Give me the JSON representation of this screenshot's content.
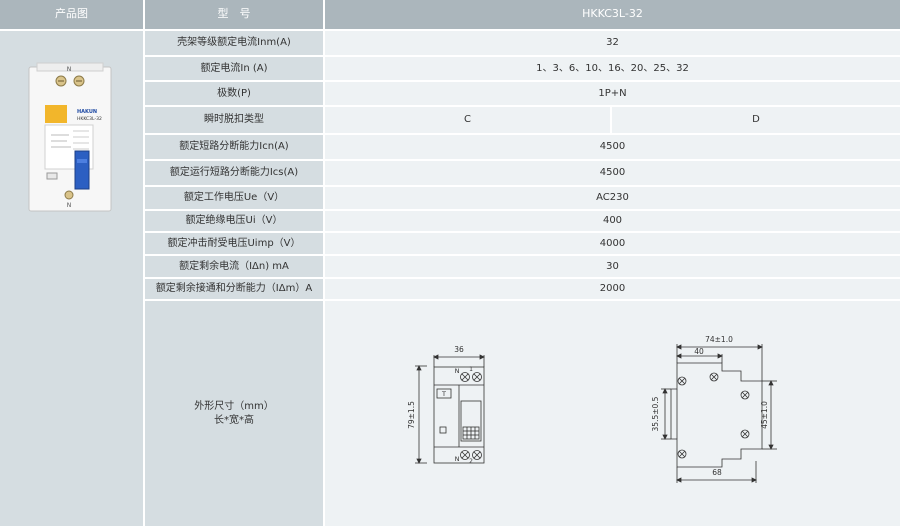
{
  "header": {
    "image_col": "产品图",
    "model_col": "型　号",
    "model_value": "HKKC3L-32"
  },
  "rows": [
    {
      "label": "壳架等级额定电流Inm(A)",
      "value": "32"
    },
    {
      "label": "额定电流In (A)",
      "value": "1、3、6、10、16、20、25、32"
    },
    {
      "label": "极数(P)",
      "value": "1P+N"
    },
    {
      "label": "瞬时脱扣类型",
      "value_c": "C",
      "value_d": "D"
    },
    {
      "label": "额定短路分断能力Icn(A)",
      "value": "4500"
    },
    {
      "label": "额定运行短路分断能力Ics(A)",
      "value": "4500"
    },
    {
      "label": "额定工作电压Ue（V）",
      "value": "AC230"
    },
    {
      "label": "额定绝缘电压Ui（V）",
      "value": "400"
    },
    {
      "label": "额定冲击耐受电压Uimp（V）",
      "value": "4000"
    },
    {
      "label": "额定剩余电流（IΔn) mA",
      "value": "30"
    },
    {
      "label": "额定剩余接通和分断能力（IΔm）A",
      "value": "2000"
    }
  ],
  "dimensions": {
    "label_line1": "外形尺寸（mm）",
    "label_line2": "长*宽*高",
    "front": {
      "width": "36",
      "height": "79±1.5",
      "t_label": "T",
      "n_top": "N",
      "n_bottom": "N",
      "num_top": "1",
      "num_bottom": "2"
    },
    "side": {
      "overall_width": "74±1.0",
      "top_width": "40",
      "bottom_width": "68",
      "left_height": "35.5±0.5",
      "right_height": "45±1.0"
    }
  },
  "product": {
    "brand": "HAKUN",
    "model": "HKKC3L-32",
    "n_top": "N",
    "n_bottom": "N"
  },
  "colors": {
    "header_bg": "#abb6bc",
    "label_bg": "#d5dde1",
    "value_bg": "#eef2f4",
    "grid_line": "#ffffff"
  }
}
